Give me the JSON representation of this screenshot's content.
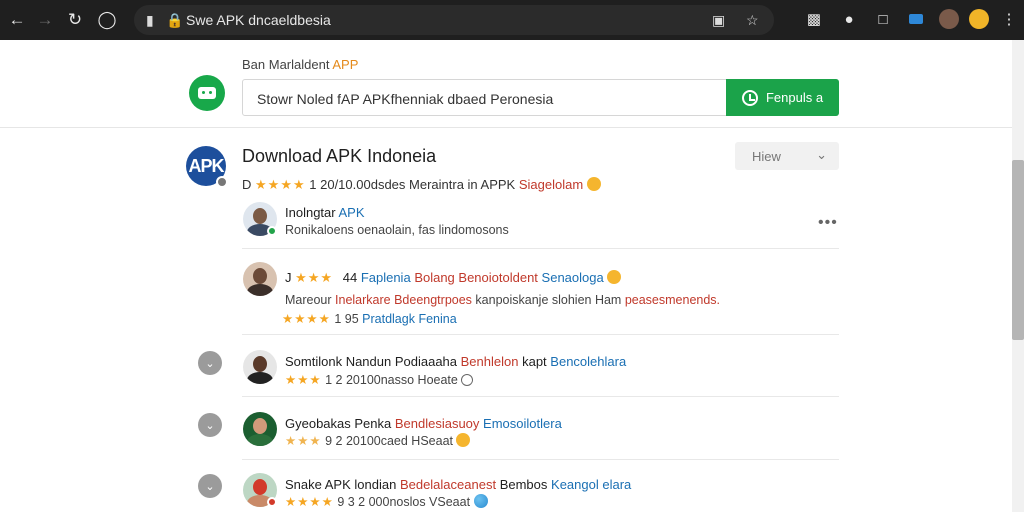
{
  "browser": {
    "url": "Swe APK dncaeldbesia"
  },
  "header": {
    "brand_prefix": "Ban Marlaldent",
    "brand_accent": "APP",
    "search_value": "Stowr Noled fAP APKfhenniak dbaed Peronesia",
    "search_button_label": "Fenpuls a"
  },
  "page": {
    "avatar_text": "APK",
    "title": "Download APK Indoneia",
    "filter_label": "Hiew",
    "rating_prefix": "D",
    "rating_stars": "★★★★",
    "rating_text": "1 20/10.00dsdes Meraintra in APPK",
    "rating_highlight": "Siagelolam"
  },
  "rows": [
    {
      "title": "Inolngtar",
      "title_blue": "APK",
      "sub": "Ronikaloens oenaolain, fas lindomosons"
    },
    {
      "title_prefix": "J",
      "stars": "★★★",
      "num": "44",
      "blue1": "Faplenia",
      "red1": "Bolang Benoiotoldent",
      "blue2": "Senaologa",
      "line2_prefix": "Mareour",
      "line2_red": "Inelarkare Bdeengtrpoes",
      "line2_mid": "kanpoiskanje slohien Ham",
      "line2_red2": "peasesmenends.",
      "line3_stars": "★★★★",
      "line3_num": "1 95",
      "line3_blue": "Pratdlagk",
      "line3_blue2": "Fenina"
    },
    {
      "title": "Somtilonk Nandun Podiaaaha",
      "red": "Benhlelon",
      "mid": "kapt",
      "blue": "Bencolehlara",
      "stars": "★★★",
      "meta": "1 2 20100nasso Hoeate"
    },
    {
      "title": "Gyeobakas Penka",
      "red": "Bendlesiasuoy",
      "blue": "Emosoilotlera",
      "stars": "★★★",
      "meta": "9 2 20100caed HSeaat"
    },
    {
      "title": "Snake APK londian",
      "red": "Bedelalaceanest",
      "mid": "Bembos",
      "blue": "Keangol elara",
      "stars": "★★★★",
      "meta": "9 3 2 000noslos VSeaat"
    }
  ],
  "colors": {
    "accent_green": "#1ba34a",
    "brand_orange": "#e48a1b",
    "star": "#f5a623",
    "link_blue": "#1a6fb3",
    "link_red": "#c0392b"
  },
  "icons": [
    "back-icon",
    "forward-icon",
    "reload-icon",
    "info-icon",
    "lock-icon",
    "screenshot-icon",
    "bookmark-star-icon",
    "extension-icon",
    "profile-icon",
    "more-icon",
    "chevron-down-icon"
  ]
}
